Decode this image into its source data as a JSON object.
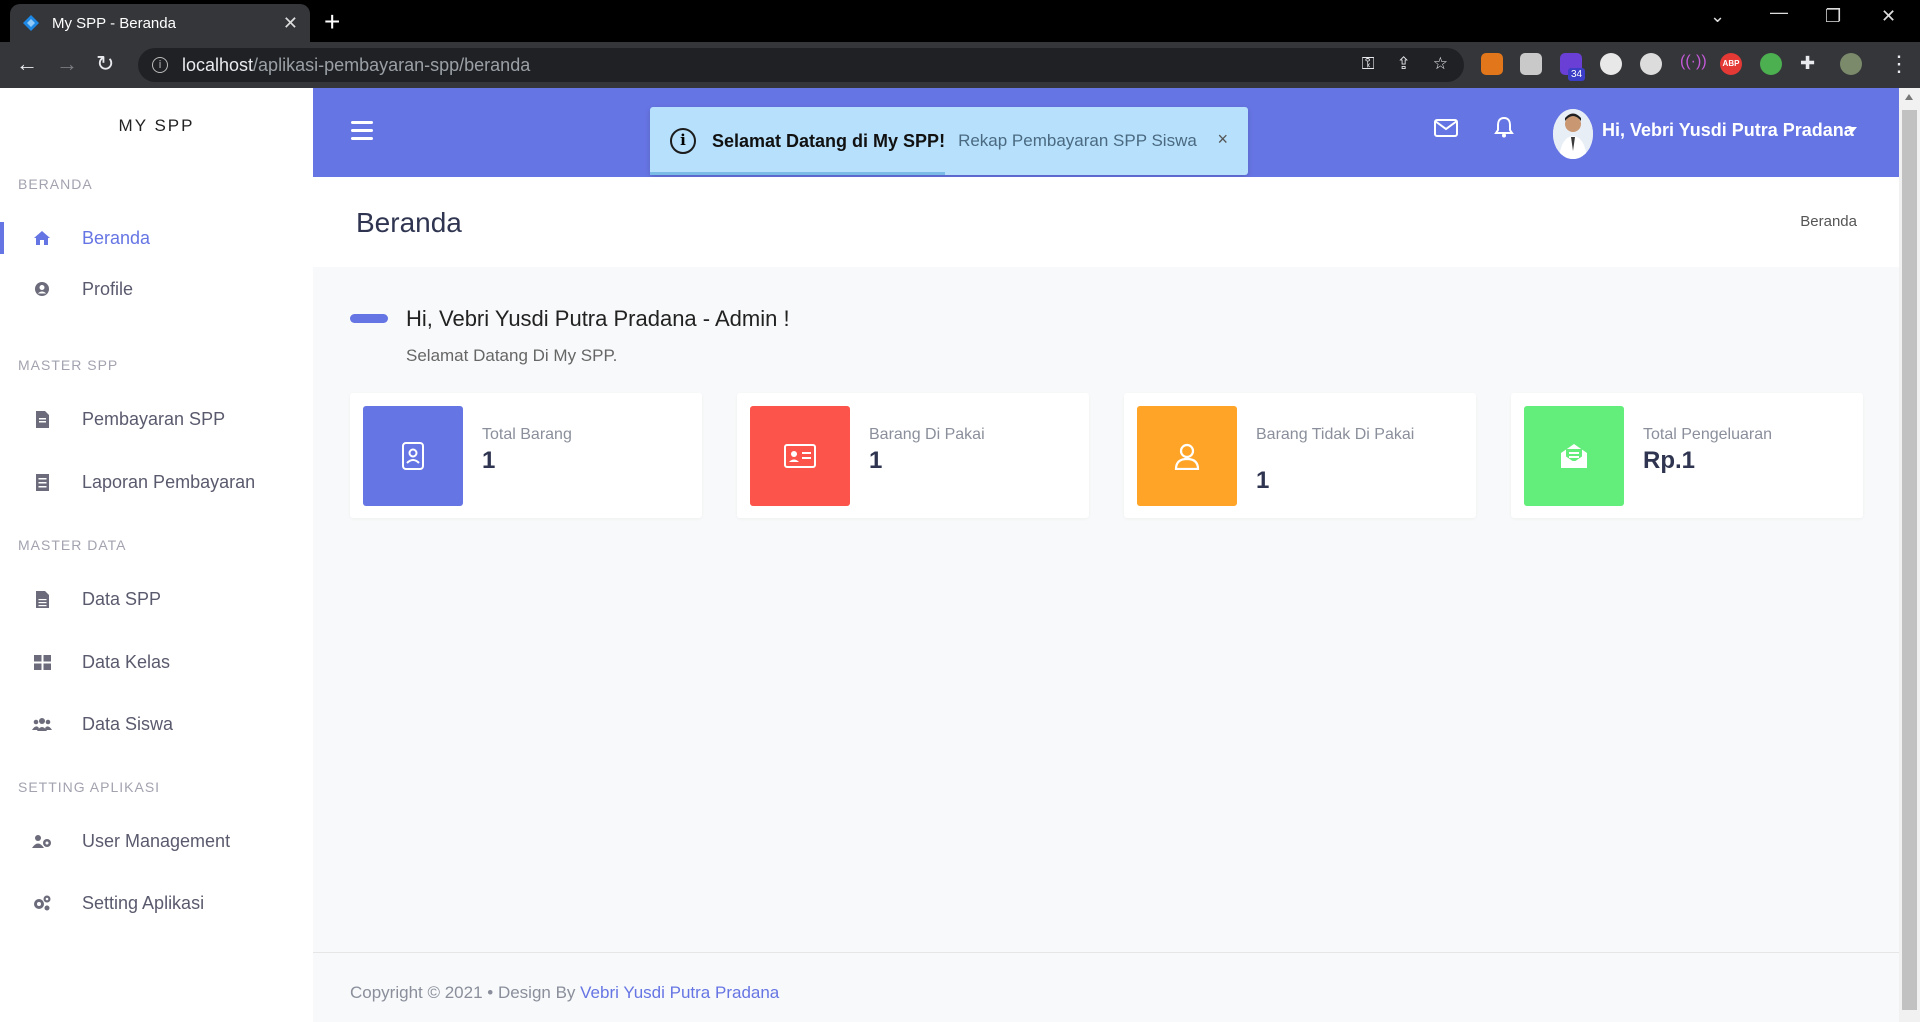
{
  "browser": {
    "tab_title": "My SPP - Beranda",
    "url_host": "localhost",
    "url_path": "/aplikasi-pembayaran-spp/beranda",
    "ext_badge": "34"
  },
  "sidebar": {
    "brand": "MY SPP",
    "sections": [
      {
        "title": "BERANDA"
      },
      {
        "title": "MASTER SPP"
      },
      {
        "title": "MASTER DATA"
      },
      {
        "title": "SETTING APLIKASI"
      }
    ],
    "items": [
      {
        "label": "Beranda",
        "icon": "home-icon",
        "active": true
      },
      {
        "label": "Profile",
        "icon": "user-circle-icon"
      },
      {
        "label": "Pembayaran SPP",
        "icon": "invoice-icon"
      },
      {
        "label": "Laporan Pembayaran",
        "icon": "report-icon"
      },
      {
        "label": "Data SPP",
        "icon": "file-icon"
      },
      {
        "label": "Data Kelas",
        "icon": "grid-icon"
      },
      {
        "label": "Data Siswa",
        "icon": "users-icon"
      },
      {
        "label": "User Management",
        "icon": "user-cog-icon"
      },
      {
        "label": "Setting Aplikasi",
        "icon": "cogs-icon"
      }
    ]
  },
  "topbar": {
    "user_name": "Hi, Vebri Yusdi Putra Pradana"
  },
  "toast": {
    "title": "Selamat Datang di My SPP!",
    "message": "Rekap Pembayaran SPP Siswa",
    "close": "×"
  },
  "page": {
    "title": "Beranda",
    "breadcrumb": "Beranda",
    "welcome_title": "Hi, Vebri Yusdi Putra Pradana - Admin !",
    "welcome_sub": "Selamat Datang Di My SPP."
  },
  "cards": [
    {
      "label": "Total Barang",
      "value": "1",
      "color": "#6675e4",
      "icon": "badge-icon"
    },
    {
      "label": "Barang Di Pakai",
      "value": "1",
      "color": "#fc544b",
      "icon": "id-card-icon"
    },
    {
      "label": "Barang Tidak Di Pakai",
      "value": "1",
      "color": "#ffa426",
      "icon": "user-icon"
    },
    {
      "label": "Total Pengeluaran",
      "value": "Rp.1",
      "color": "#63ed7a",
      "icon": "envelope-open-icon"
    }
  ],
  "footer": {
    "text": "Copyright © 2021 • Design By ",
    "author": "Vebri Yusdi Putra Pradana"
  },
  "colors": {
    "primary": "#6675e4",
    "toast_bg": "#b6e0fb"
  }
}
